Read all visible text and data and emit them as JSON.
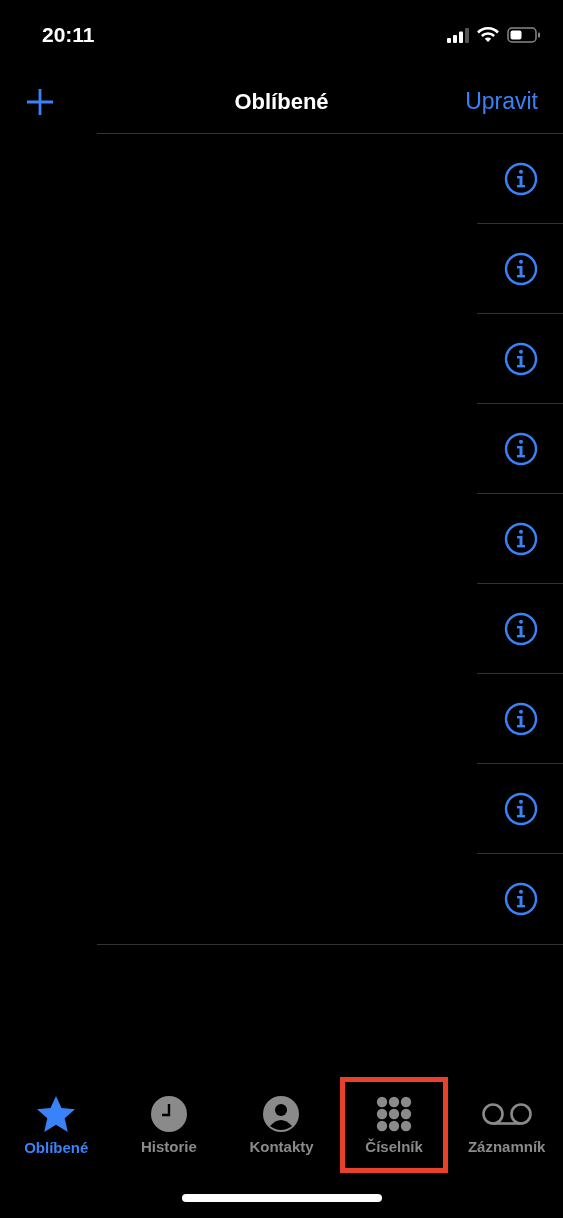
{
  "status_bar": {
    "time": "20:11"
  },
  "nav": {
    "title": "Oblíbené",
    "edit": "Upravit"
  },
  "favorites": [
    {
      "kind": "info"
    },
    {
      "kind": "info"
    },
    {
      "kind": "info"
    },
    {
      "kind": "info"
    },
    {
      "kind": "info"
    },
    {
      "kind": "info"
    },
    {
      "kind": "info"
    },
    {
      "kind": "info"
    },
    {
      "kind": "info"
    }
  ],
  "tabs": [
    {
      "label": "Oblíbené",
      "kind": "star",
      "selected": true,
      "highlighted": false
    },
    {
      "label": "Historie",
      "kind": "clock",
      "selected": false,
      "highlighted": false
    },
    {
      "label": "Kontakty",
      "kind": "person",
      "selected": false,
      "highlighted": false
    },
    {
      "label": "Číselník",
      "kind": "keypad",
      "selected": false,
      "highlighted": true
    },
    {
      "label": "Záznamník",
      "kind": "voicemail",
      "selected": false,
      "highlighted": false
    }
  ]
}
